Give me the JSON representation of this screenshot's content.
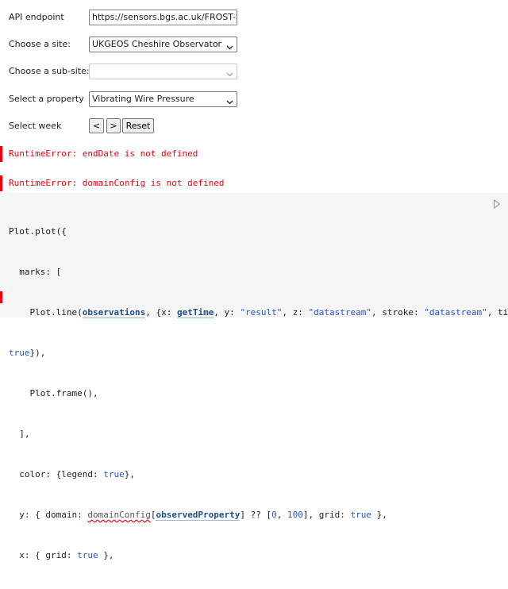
{
  "form": {
    "api_endpoint": {
      "label": "API endpoint",
      "value": "https://sensors.bgs.ac.uk/FROST-Server"
    },
    "site": {
      "label": "Choose a site:",
      "value": "UKGEOS Cheshire Observatory"
    },
    "subsite": {
      "label": "Choose a sub-site:",
      "value": ""
    },
    "property": {
      "label": "Select a property",
      "value": "Vibrating Wire Pressure"
    },
    "week": {
      "label": "Select week",
      "prev_label": "<",
      "next_label": ">",
      "reset_label": "Reset"
    }
  },
  "errors": [
    "RuntimeError: endDate is not defined",
    "RuntimeError: domainConfig is not defined"
  ],
  "code": {
    "line1": "Plot.plot({",
    "line2": "  marks: [",
    "line3a": "    Plot.line(",
    "line3_observations": "observations",
    "line3b": ", {x: ",
    "line3_getTime": "getTime",
    "line3c": ", y: ",
    "line3_result": "\"result\"",
    "line3d": ", z: ",
    "line3_ds1": "\"datastream\"",
    "line3e": ", stroke: ",
    "line3_ds2": "\"datastream\"",
    "line3f": ", tip:",
    "line4a": "true",
    "line4b": "}),",
    "line5": "    Plot.frame(),",
    "line6": "  ],",
    "line7a": "  color: {legend: ",
    "line7_true": "true",
    "line7b": "},",
    "line8a": "  y: { domain: ",
    "line8_domainConfig": "domainConfig",
    "line8b": "[",
    "line8_observedProperty": "observedProperty",
    "line8c": "] ?? [",
    "line8_zero": "0",
    "line8d": ", ",
    "line8_hundred": "100",
    "line8e": "], grid: ",
    "line8_true": "true",
    "line8f": " },",
    "line9a": "  x: { grid: ",
    "line9_true": "true",
    "line9b": " },"
  },
  "icons": {
    "run": "play-icon",
    "dropdown": "chevron-down-icon"
  },
  "colors": {
    "error": "#e7040f",
    "string": "#2a55c9",
    "reference": "#1d4e89",
    "code_background": "#f5f5f5"
  }
}
